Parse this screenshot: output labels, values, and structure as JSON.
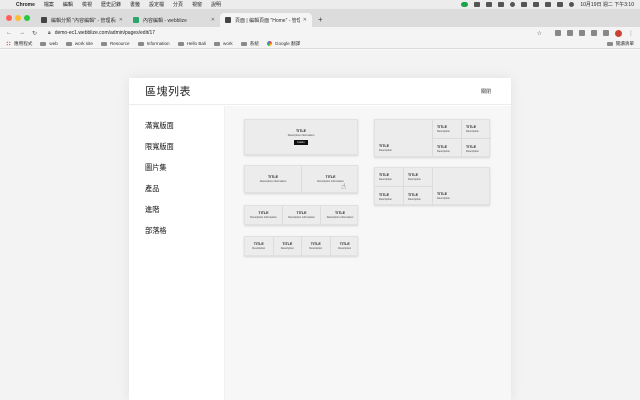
{
  "menubar": {
    "items": [
      "Chrome",
      "檔案",
      "編輯",
      "檢視",
      "歷史記錄",
      "書籤",
      "設定檔",
      "分頁",
      "視窗",
      "說明"
    ],
    "clock": "10月19日 週二 下午3:10"
  },
  "tabs": [
    {
      "title": "編輯分類 \"內容編輯\" - 管理系統",
      "active": false
    },
    {
      "title": "內容編輯 - webblize",
      "active": false
    },
    {
      "title": "頁面 | 編輯頁面 \"Home\" - 管理系統",
      "active": true
    }
  ],
  "address": {
    "url": "demo-ec1.webblize.com/admin/pages/edit/17"
  },
  "bookmarks": {
    "items": [
      {
        "label": "應用程式",
        "icon": "apps-icon"
      },
      {
        "label": "web",
        "icon": "folder-icon"
      },
      {
        "label": "work site",
        "icon": "folder-icon"
      },
      {
        "label": "Resource",
        "icon": "folder-icon"
      },
      {
        "label": "Information",
        "icon": "folder-icon"
      },
      {
        "label": "Hello Bali",
        "icon": "folder-icon"
      },
      {
        "label": "work",
        "icon": "folder-icon"
      },
      {
        "label": "系統",
        "icon": "folder-icon"
      },
      {
        "label": "Google 翻譯",
        "icon": "google-icon"
      }
    ],
    "reading_list": "閱讀清單"
  },
  "modal": {
    "title": "區塊列表",
    "close_label": "關閉",
    "sidebar": [
      "滿寬版面",
      "限寬版面",
      "圖片集",
      "產品",
      "進階",
      "部落格"
    ]
  },
  "templates": {
    "hero": {
      "title": "TITLE",
      "description": "Description information",
      "button": "button"
    },
    "two_col": [
      {
        "title": "TITLE",
        "description": "Description information"
      },
      {
        "title": "TITLE",
        "description": "Description information"
      }
    ],
    "three_col": [
      {
        "title": "TITLE",
        "description": "Description information"
      },
      {
        "title": "TITLE",
        "description": "Description information"
      },
      {
        "title": "TITLE",
        "description": "Description information"
      }
    ],
    "four_col": [
      {
        "title": "TITLE",
        "description": "Description"
      },
      {
        "title": "TITLE",
        "description": "Description"
      },
      {
        "title": "TITLE",
        "description": "Description"
      },
      {
        "title": "TITLE",
        "description": "Description"
      }
    ],
    "grid_left_big": {
      "big": {
        "title": "TITLE",
        "description": "Description"
      },
      "small": [
        {
          "title": "TITLE",
          "description": "Description"
        },
        {
          "title": "TITLE",
          "description": "Description"
        },
        {
          "title": "TITLE",
          "description": "Description"
        },
        {
          "title": "TITLE",
          "description": "Description"
        }
      ]
    },
    "grid_right_big": {
      "big": {
        "title": "TITLE",
        "description": "Description"
      },
      "small": [
        {
          "title": "TITLE",
          "description": "Description"
        },
        {
          "title": "TITLE",
          "description": "Description"
        },
        {
          "title": "TITLE",
          "description": "Description"
        },
        {
          "title": "TITLE",
          "description": "Description"
        }
      ]
    }
  }
}
